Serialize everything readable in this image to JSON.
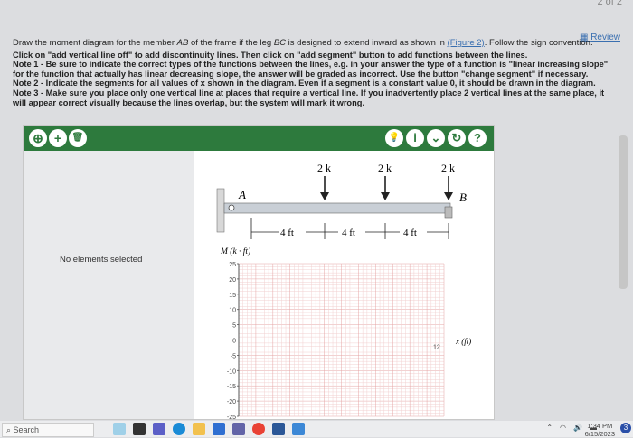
{
  "page_indicator": "2 of 2",
  "review_link": "Review",
  "problem": {
    "question_pre": "Draw the moment diagram for the member ",
    "member": "AB",
    "question_mid": " of the frame if the leg ",
    "leg": "BC",
    "question_post": " is designed to extend inward as shown in ",
    "figure_link": "(Figure 2)",
    "question_end": ". Follow the sign convention.",
    "instructions": [
      "Click on \"add vertical line off\" to add discontinuity lines. Then click on \"add segment\" button to add functions between the lines.",
      "Note 1 - Be sure to indicate the correct types of the functions between the lines, e.g. in your answer the type of a function is \"linear increasing slope\" for the function that actually has linear decreasing slope, the answer will be graded as incorrect. Use the button \"change segment\" if necessary.",
      "Note 2 - Indicate the segments for all values of x shown in the diagram. Even if a segment is a constant value 0, it should be drawn in the diagram.",
      "Note 3 - Make sure you place only one vertical line at places that require a vertical line. If you inadvertently place 2 vertical lines at the same place, it will appear correct visually because the lines overlap, but the system will mark it wrong."
    ]
  },
  "toolbar": {
    "left_buttons": [
      {
        "name": "add-vertical-line-button",
        "glyph": "⊕"
      },
      {
        "name": "add-segment-button",
        "glyph": "+"
      },
      {
        "name": "delete-button",
        "glyph": "🗑"
      }
    ],
    "right_buttons": [
      {
        "name": "hint-button",
        "glyph": "💡"
      },
      {
        "name": "info-button",
        "glyph": "i"
      },
      {
        "name": "dropdown-button",
        "glyph": "⌄"
      },
      {
        "name": "reset-button",
        "glyph": "↻"
      },
      {
        "name": "help-button",
        "glyph": "?"
      }
    ]
  },
  "sidebar": {
    "status": "No elements selected"
  },
  "diagram": {
    "loads": [
      "2 k",
      "2 k",
      "2 k"
    ],
    "point_a": "A",
    "point_b": "B",
    "dims": [
      "4 ft",
      "4 ft",
      "4 ft"
    ]
  },
  "plot": {
    "ylabel": "M (k · ft)",
    "xlabel": "x (ft)",
    "x_end_label": "12",
    "yticks": [
      "25",
      "20",
      "15",
      "10",
      "5",
      "0",
      "-5",
      "-10",
      "-15",
      "-20",
      "-25"
    ],
    "ylim": [
      -25,
      25
    ],
    "xlim": [
      0,
      12
    ],
    "grid": true
  },
  "taskbar": {
    "search": "Search",
    "time": "1:34 PM",
    "date": "6/15/2023",
    "notifications": "3"
  }
}
